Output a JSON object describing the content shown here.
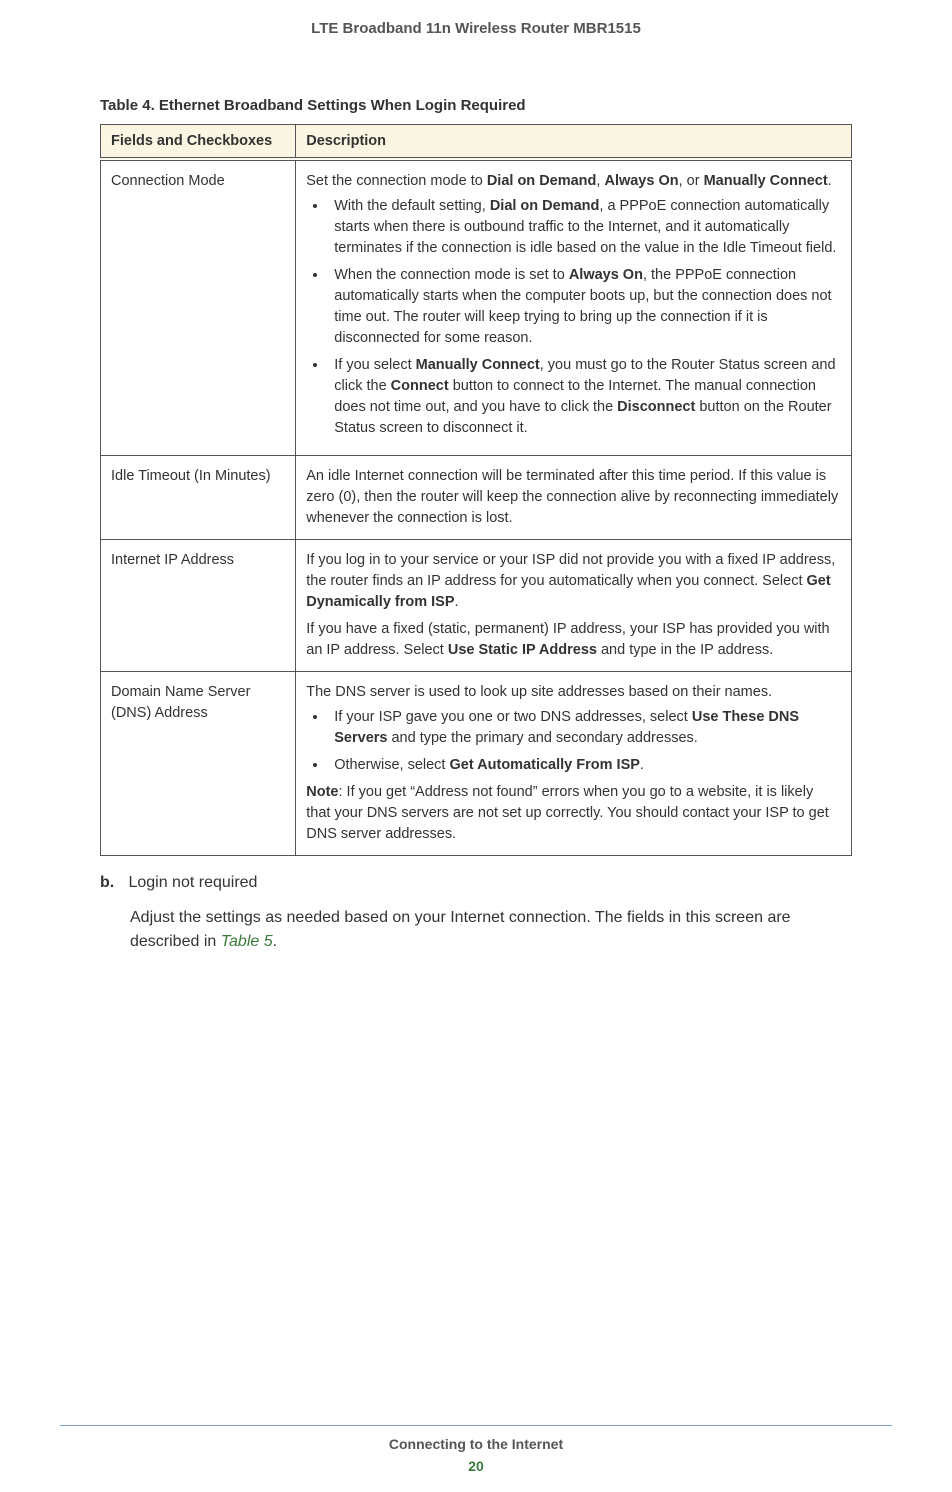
{
  "header": "LTE Broadband 11n Wireless Router MBR1515",
  "table_caption": "Table 4.  Ethernet Broadband Settings When Login Required",
  "table_headers": {
    "col1": "Fields and Checkboxes",
    "col2": "Description"
  },
  "rows": {
    "connection_mode": {
      "field": "Connection Mode",
      "intro_pre": "Set the connection mode to ",
      "b1": "Dial on Demand",
      "sep1": ", ",
      "b2": "Always On",
      "sep2": ", or ",
      "b3": "Manually Connect",
      "intro_post": ".",
      "bul1_pre": "With the default setting, ",
      "bul1_b": "Dial on Demand",
      "bul1_post": ", a PPPoE connection automatically starts when there is outbound traffic to the Internet, and it automatically terminates if the connection is idle based on the value in the Idle Timeout field.",
      "bul2_pre": "When the connection mode is set to ",
      "bul2_b": "Always On",
      "bul2_post": ", the PPPoE connection automatically starts when the computer boots up, but the connection does not time out. The router will keep trying to bring up the connection if it is disconnected for some reason.",
      "bul3_pre": "If you select ",
      "bul3_b1": "Manually Connect",
      "bul3_mid1": ", you must go to the Router Status screen and click the ",
      "bul3_b2": "Connect",
      "bul3_mid2": " button to connect to the Internet. The manual connection does not time out, and you have to click the ",
      "bul3_b3": "Disconnect",
      "bul3_post": " button on the Router Status screen to disconnect it."
    },
    "idle_timeout": {
      "field": "Idle Timeout (In Minutes)",
      "desc": "An idle Internet connection will be terminated after this time period. If this value is zero (0), then the router will keep the connection alive by reconnecting immediately whenever the connection is lost."
    },
    "internet_ip": {
      "field": "Internet IP Address",
      "p1_pre": "If you log in to your service or your ISP did not provide you with a fixed IP address, the router finds an IP address for you automatically when you connect. Select ",
      "p1_b": "Get Dynamically from ISP",
      "p1_post": ".",
      "p2_pre": "If you have a fixed (static, permanent) IP address, your ISP has provided you with an IP address. Select ",
      "p2_b": "Use Static IP Address",
      "p2_post": " and type in the IP address."
    },
    "dns": {
      "field": "Domain Name Server (DNS) Address",
      "intro": "The DNS server is used to look up site addresses based on their names.",
      "bul1_pre": "If your ISP gave you one or two DNS addresses, select ",
      "bul1_b": "Use These DNS Servers",
      "bul1_post": " and type the primary and secondary addresses.",
      "bul2_pre": "Otherwise, select ",
      "bul2_b": "Get Automatically From ISP",
      "bul2_post": ".",
      "note_b": "Note",
      "note_post": ": If you get “Address not found” errors when you go to a website, it is likely that your DNS servers are not set up correctly. You should contact your ISP to get DNS server addresses."
    }
  },
  "section_b": {
    "label": "b.",
    "title": "Login not required",
    "desc_pre": "Adjust the settings as needed based on your Internet connection. The fields in this screen are described in ",
    "desc_link": "Table 5",
    "desc_post": "."
  },
  "footer": {
    "title": "Connecting to the Internet",
    "page": "20"
  }
}
